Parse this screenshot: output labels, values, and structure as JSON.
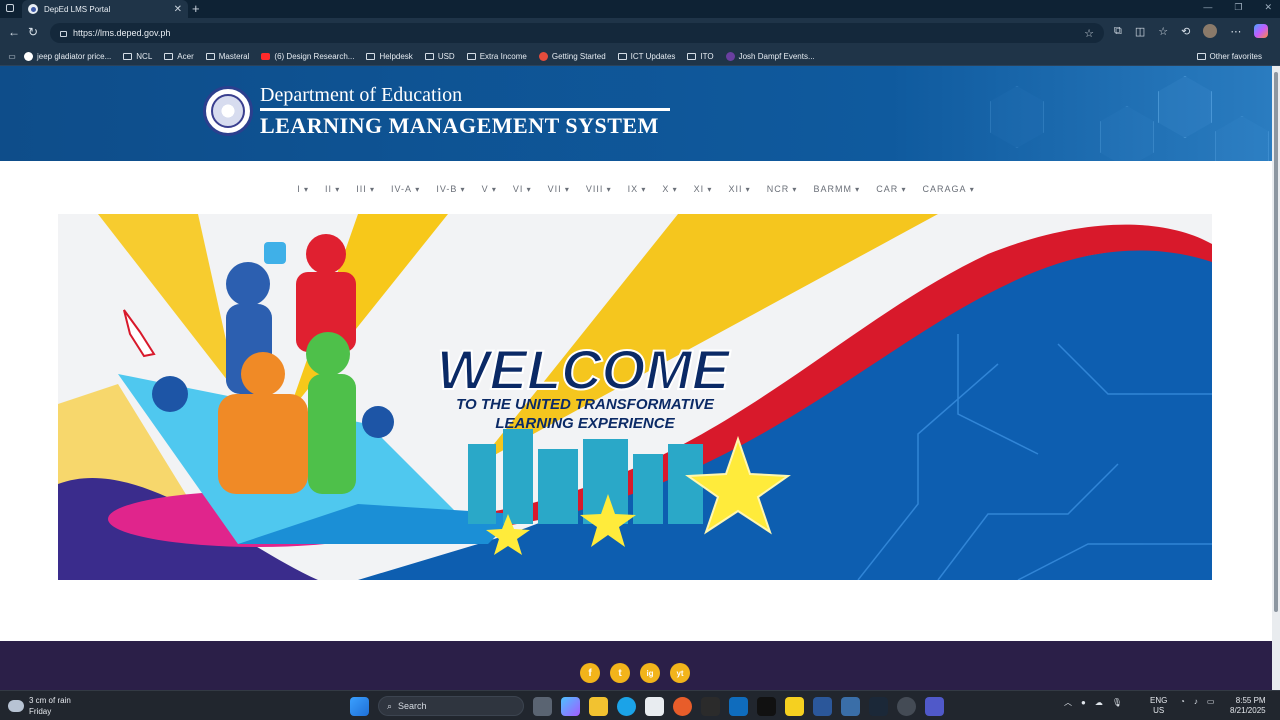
{
  "browser": {
    "tab_title": "DepEd LMS Portal",
    "url": "https://lms.deped.gov.ph",
    "bookmarks": [
      "jeep gladiator price...",
      "NCL",
      "Acer",
      "Masteral",
      "(6) Design Research...",
      "Helpdesk",
      "USD",
      "Extra Income",
      "Getting Started",
      "ICT Updates",
      "ITO",
      "Josh Dampf Events..."
    ],
    "other_favorites": "Other favorites"
  },
  "header": {
    "department": "Department of Education",
    "system": "LEARNING MANAGEMENT SYSTEM"
  },
  "regions": [
    "I",
    "II",
    "III",
    "IV-A",
    "IV-B",
    "V",
    "VI",
    "VII",
    "VIII",
    "IX",
    "X",
    "XI",
    "XII",
    "NCR",
    "BARMM",
    "CAR",
    "CARAGA"
  ],
  "banner": {
    "headline": "WELCOME",
    "sub1": "TO THE UNITED TRANSFORMATIVE",
    "sub2": "LEARNING EXPERIENCE"
  },
  "social": [
    "f",
    "t",
    "ig",
    "yt"
  ],
  "taskbar": {
    "weather_line1": "3 cm of rain",
    "weather_line2": "Friday",
    "search": "Search",
    "lang1": "ENG",
    "lang2": "US",
    "time": "8:55 PM",
    "date": "8/21/2025"
  },
  "colors": {
    "header_blue": "#0f5a9e",
    "footer_purple": "#2b1f48",
    "social_gold": "#f2b41b",
    "banner_red": "#d8192b",
    "banner_blue": "#0d5eb0"
  }
}
